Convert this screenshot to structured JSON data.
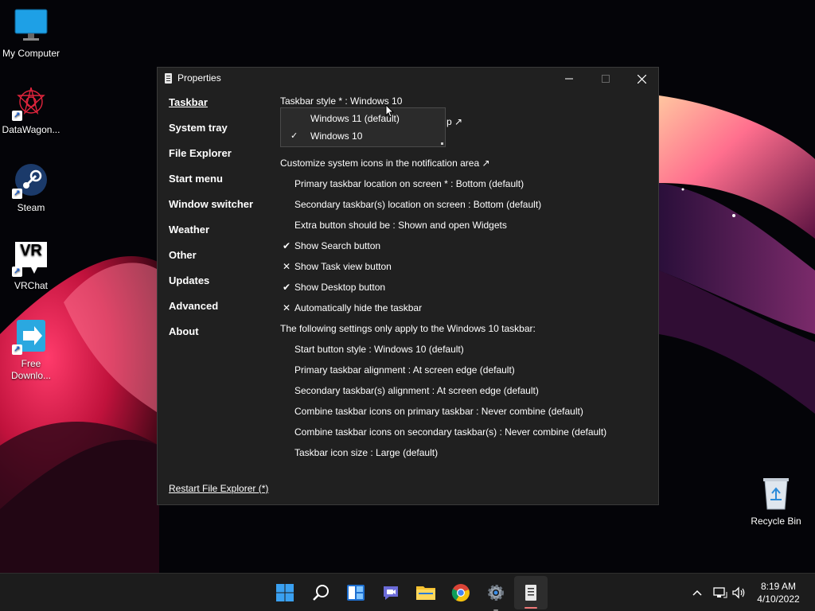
{
  "desktop": {
    "icons": [
      {
        "label": "My Computer",
        "icon": "monitor-icon"
      },
      {
        "label": "DataWagon...",
        "icon": "datawagon-icon"
      },
      {
        "label": "Steam",
        "icon": "steam-icon"
      },
      {
        "label": "VRChat",
        "icon": "vrchat-icon",
        "icon_text": "VR"
      },
      {
        "label": "Free Downlo...",
        "icon": "free-download-manager-icon"
      },
      {
        "label": "Recycle Bin",
        "icon": "recycle-bin-icon"
      }
    ]
  },
  "window": {
    "title": "Properties",
    "nav": [
      {
        "label": "Taskbar",
        "active": true
      },
      {
        "label": "System tray"
      },
      {
        "label": "File Explorer"
      },
      {
        "label": "Start menu"
      },
      {
        "label": "Window switcher"
      },
      {
        "label": "Weather"
      },
      {
        "label": "Other"
      },
      {
        "label": "Updates"
      },
      {
        "label": "Advanced"
      },
      {
        "label": "About"
      }
    ],
    "taskbar_style_label": "Taskbar style * : Windows 10",
    "hidden_row_suffix": "p ↗",
    "dropdown": {
      "options": [
        {
          "label": "Windows 11 (default)",
          "checked": false
        },
        {
          "label": "Windows 10",
          "checked": true
        }
      ]
    },
    "settings": [
      {
        "label": "Customize system icons in the notification area ↗",
        "indent": false,
        "mark": ""
      },
      {
        "label": "Primary taskbar location on screen * : Bottom (default)",
        "indent": true,
        "mark": ""
      },
      {
        "label": "Secondary taskbar(s) location on screen : Bottom (default)",
        "indent": true,
        "mark": ""
      },
      {
        "label": "Extra button should be : Shown and open Widgets",
        "indent": true,
        "mark": ""
      },
      {
        "label": "Show Search button",
        "indent": true,
        "mark": "✔"
      },
      {
        "label": "Show Task view button",
        "indent": true,
        "mark": "✕"
      },
      {
        "label": "Show Desktop button",
        "indent": true,
        "mark": "✔"
      },
      {
        "label": "Automatically hide the taskbar",
        "indent": true,
        "mark": "✕"
      },
      {
        "label": "The following settings only apply to the Windows 10 taskbar:",
        "indent": false,
        "mark": ""
      },
      {
        "label": "Start button style : Windows 10 (default)",
        "indent": true,
        "mark": ""
      },
      {
        "label": "Primary taskbar alignment : At screen edge (default)",
        "indent": true,
        "mark": ""
      },
      {
        "label": "Secondary taskbar(s) alignment : At screen edge (default)",
        "indent": true,
        "mark": ""
      },
      {
        "label": "Combine taskbar icons on primary taskbar : Never combine (default)",
        "indent": true,
        "mark": ""
      },
      {
        "label": "Combine taskbar icons on secondary taskbar(s) : Never combine (default)",
        "indent": true,
        "mark": ""
      },
      {
        "label": "Taskbar icon size : Large (default)",
        "indent": true,
        "mark": ""
      }
    ],
    "restart_link": "Restart File Explorer (*)"
  },
  "taskbar": {
    "apps": [
      {
        "name": "start-button",
        "icon": "windows-logo-icon"
      },
      {
        "name": "search-button",
        "icon": "search-icon"
      },
      {
        "name": "widgets-button",
        "icon": "widgets-icon"
      },
      {
        "name": "chat-button",
        "icon": "teams-chat-icon"
      },
      {
        "name": "file-explorer-button",
        "icon": "folder-icon"
      },
      {
        "name": "chrome-button",
        "icon": "chrome-icon"
      },
      {
        "name": "settings-button",
        "icon": "gear-icon"
      },
      {
        "name": "properties-button",
        "icon": "properties-app-icon"
      }
    ],
    "time": "8:19 AM",
    "date": "4/10/2022"
  },
  "colors": {
    "window_bg": "#202020",
    "taskbar_bg": "#1c1c1c",
    "accent": "#0078d4"
  }
}
